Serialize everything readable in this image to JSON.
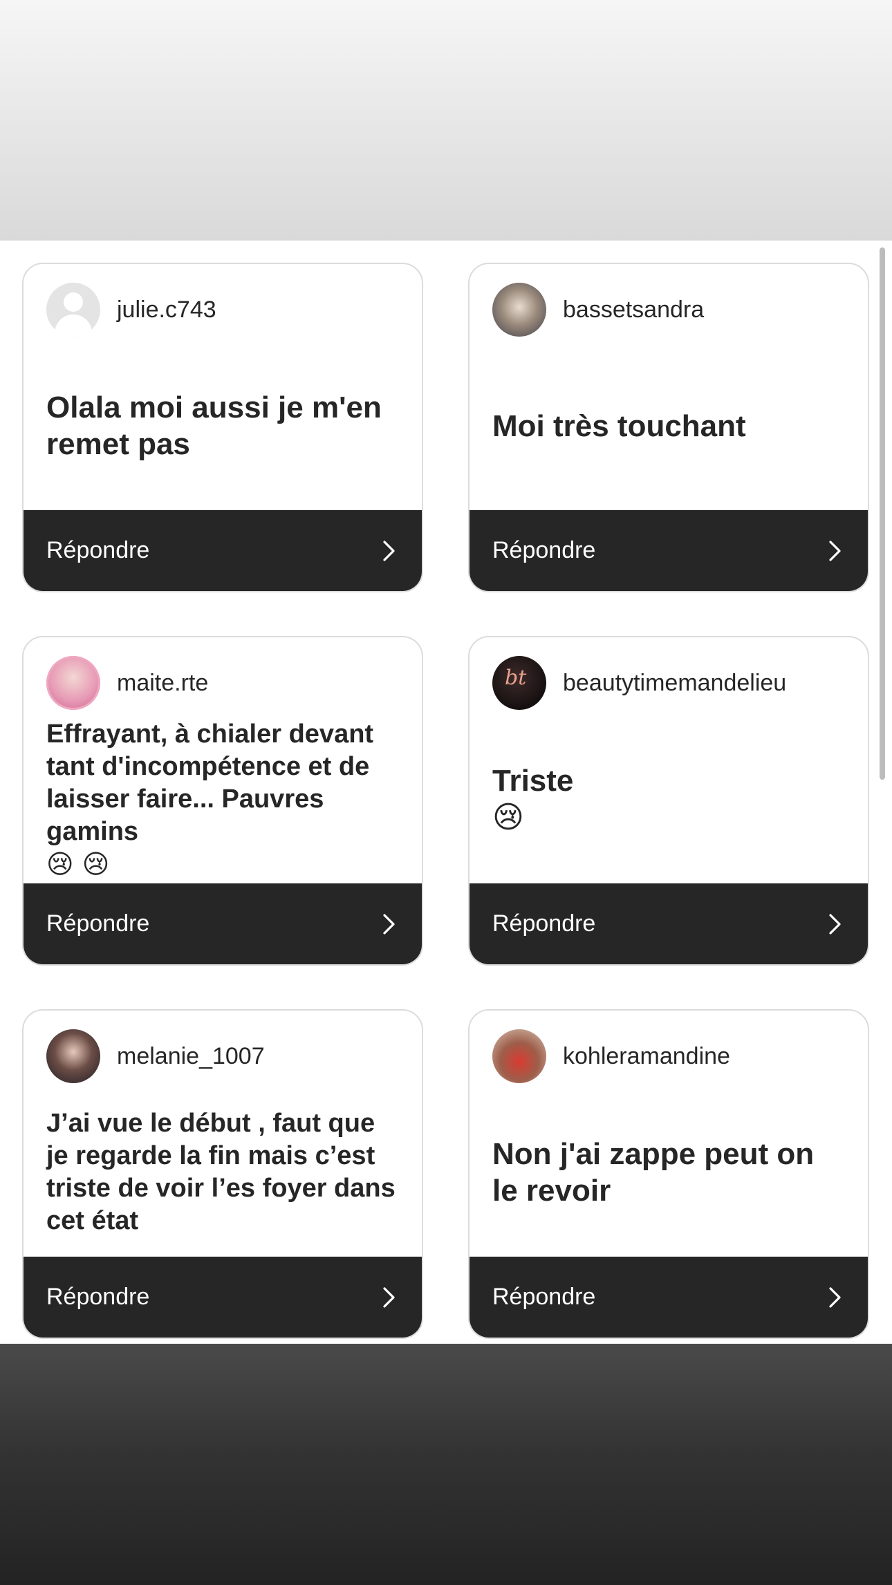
{
  "reply_label": "Répondre",
  "cards": [
    {
      "username": "julie.c743",
      "comment": "Olala moi aussi je m'en remet pas",
      "avatar": "default-user-icon"
    },
    {
      "username": "bassetsandra",
      "comment": "Moi très touchant",
      "avatar": "profile-photo"
    },
    {
      "username": "maite.rte",
      "comment": "Effrayant, à chialer devant tant d'incompétence et de laisser faire... Pauvres gamins",
      "emoji": "😢 😢",
      "avatar": "profile-photo"
    },
    {
      "username": "beautytimemandelieu",
      "comment": "Triste",
      "emoji": "😢",
      "avatar": "logo-photo"
    },
    {
      "username": "melanie_1007",
      "comment": "J’ai vue le début , faut que je regarde la fin mais c’est triste de voir l’es foyer dans cet état",
      "avatar": "profile-photo"
    },
    {
      "username": "kohleramandine",
      "comment": "Non j'ai zappe peut on le revoir",
      "avatar": "profile-photo"
    }
  ],
  "colors": {
    "reply_bar": "#262626",
    "card_border": "#dcdcdc",
    "text": "#262626"
  }
}
